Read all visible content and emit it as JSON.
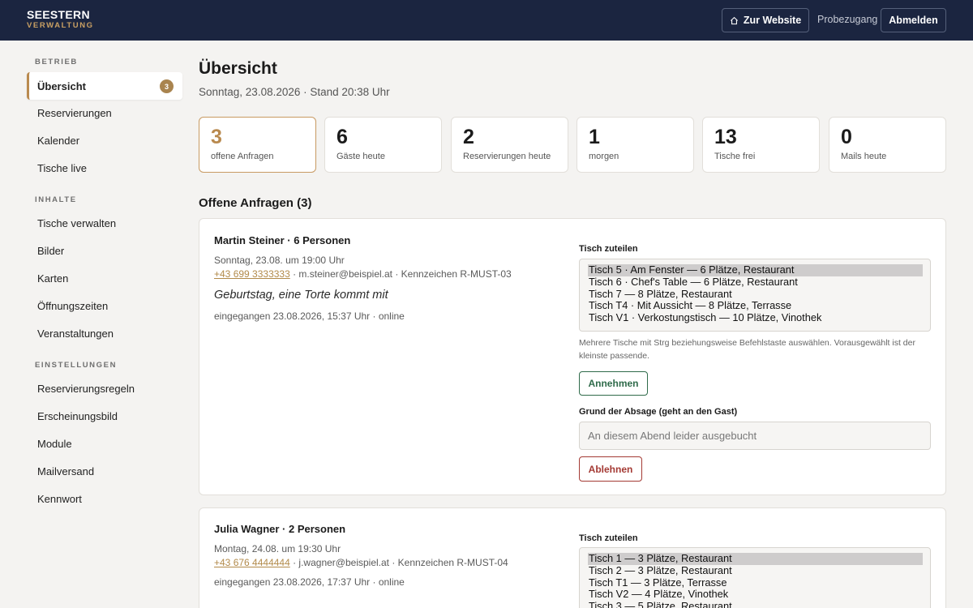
{
  "header": {
    "brand": "SEESTERN",
    "brand_sub": "VERWALTUNG",
    "website_button": "Zur Website",
    "trial_label": "Probezugang",
    "logout_button": "Abmelden"
  },
  "sidebar": {
    "sections": [
      {
        "title": "BETRIEB",
        "items": [
          {
            "label": "Übersicht",
            "active": true,
            "badge": "3"
          },
          {
            "label": "Reservierungen"
          },
          {
            "label": "Kalender"
          },
          {
            "label": "Tische live"
          }
        ]
      },
      {
        "title": "INHALTE",
        "items": [
          {
            "label": "Tische verwalten"
          },
          {
            "label": "Bilder"
          },
          {
            "label": "Karten"
          },
          {
            "label": "Öffnungszeiten"
          },
          {
            "label": "Veranstaltungen"
          }
        ]
      },
      {
        "title": "EINSTELLUNGEN",
        "items": [
          {
            "label": "Reservierungsregeln"
          },
          {
            "label": "Erscheinungsbild"
          },
          {
            "label": "Module"
          },
          {
            "label": "Mailversand"
          },
          {
            "label": "Kennwort"
          }
        ]
      }
    ]
  },
  "main": {
    "title": "Übersicht",
    "subtitle": "Sonntag, 23.08.2026 · Stand 20:38 Uhr",
    "stats": [
      {
        "value": "3",
        "label": "offene Anfragen",
        "highlight": true
      },
      {
        "value": "6",
        "label": "Gäste heute"
      },
      {
        "value": "2",
        "label": "Reservierungen heute"
      },
      {
        "value": "1",
        "label": "morgen"
      },
      {
        "value": "13",
        "label": "Tische frei"
      },
      {
        "value": "0",
        "label": "Mails heute"
      }
    ],
    "requests_title": "Offene Anfragen (3)",
    "requests": [
      {
        "name": "Martin Steiner · 6 Personen",
        "datetime": "Sonntag, 23.08. um 19:00 Uhr",
        "phone": "+43 699 3333333",
        "contact_rest": " · m.steiner@beispiel.at · Kennzeichen R-MUST-03",
        "note": "Geburtstag, eine Torte kommt mit",
        "received": "eingegangen 23.08.2026, 15:37 Uhr · online",
        "assign_label": "Tisch zuteilen",
        "tables": [
          "Tisch 5 · Am Fenster — 6 Plätze, Restaurant",
          "Tisch 6 · Chef's Table — 6 Plätze, Restaurant",
          "Tisch 7 — 8 Plätze, Restaurant",
          "Tisch T4 · Mit Aussicht — 8 Plätze, Terrasse",
          "Tisch V1 · Verkostungstisch — 10 Plätze, Vinothek"
        ],
        "hint": "Mehrere Tische mit Strg beziehungsweise Befehlstaste auswählen. Vorausgewählt ist der kleinste passende.",
        "accept_button": "Annehmen",
        "reason_label": "Grund der Absage (geht an den Gast)",
        "reason_placeholder": "An diesem Abend leider ausgebucht",
        "reject_button": "Ablehnen"
      },
      {
        "name": "Julia Wagner · 2 Personen",
        "datetime": "Montag, 24.08. um 19:30 Uhr",
        "phone": "+43 676 4444444",
        "contact_rest": " · j.wagner@beispiel.at · Kennzeichen R-MUST-04",
        "received": "eingegangen 23.08.2026, 17:37 Uhr · online",
        "assign_label": "Tisch zuteilen",
        "tables": [
          "Tisch 1 — 3 Plätze, Restaurant",
          "Tisch 2 — 3 Plätze, Restaurant",
          "Tisch T1 — 3 Plätze, Terrasse",
          "Tisch V2 — 4 Plätze, Vinothek",
          "Tisch 3 — 5 Plätze, Restaurant"
        ]
      }
    ]
  }
}
